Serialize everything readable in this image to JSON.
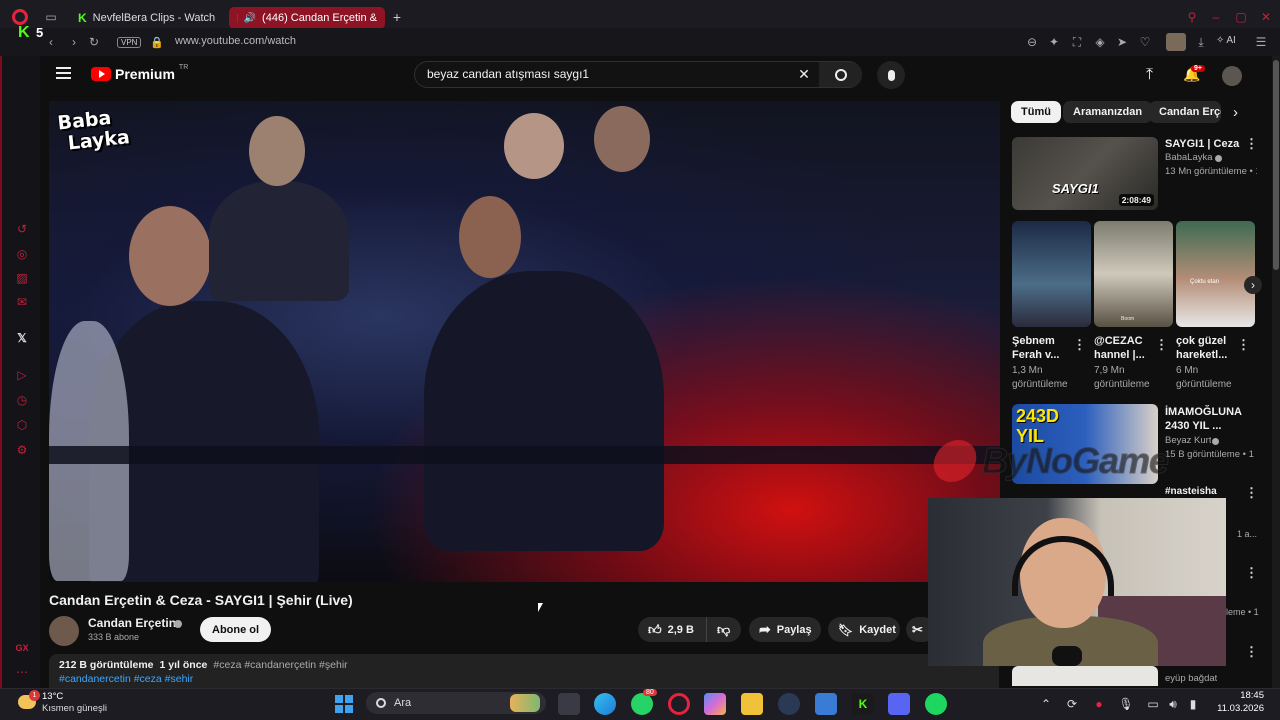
{
  "browser": {
    "badge_number": "5",
    "tabs": [
      {
        "label": "NevfelBera Clips - Watch L"
      },
      {
        "label": "(446) Candan Erçetin &"
      }
    ],
    "new_tab": "+",
    "vpn_label": "VPN",
    "url": "www.youtube.com/watch",
    "ai_label": "AI"
  },
  "youtube": {
    "logo_text": "Premium",
    "logo_sup": "TR",
    "search_value": "beyaz candan atışması saygı1",
    "notif_count": "9+"
  },
  "video": {
    "overlay_logo_line1": "Baba",
    "overlay_logo_line2": "Layka",
    "watermark": "ByNoGame",
    "title": "Candan Erçetin & Ceza - SAYGI1 | Şehir (Live)",
    "channel": "Candan Erçetin",
    "subscribers": "333 B abone",
    "subscribe_label": "Abone ol",
    "likes": "2,9 B",
    "share_label": "Paylaş",
    "save_label": "Kaydet",
    "views": "212 B görüntüleme",
    "age": "1 yıl önce",
    "hashtags_line1": "#ceza #candanerçetin #şehir",
    "hashtags_line2": "#candanercetin #ceza #sehir"
  },
  "chips": [
    "Tümü",
    "Aramanızdan",
    "Candan Erçe"
  ],
  "recommended": [
    {
      "title_line1": "SAYGI1 | Ceza",
      "channel": "BabaLayka",
      "meta": "13 Mn görüntüleme • 1",
      "duration": "2:08:49",
      "thumb_text": "SAYGI1"
    }
  ],
  "shorts": [
    {
      "title_line1": "Şebnem",
      "title_line2": "Ferah v...",
      "meta_line1": "1,3 Mn",
      "meta_line2": "görüntüleme"
    },
    {
      "title_line1": "@CEZAC",
      "title_line2": "hannel |...",
      "meta_line1": "7,9 Mn",
      "meta_line2": "görüntüleme",
      "thumb_text": "Boom"
    },
    {
      "title_line1": "çok güzel",
      "title_line2": "hareketl...",
      "meta_line1": "6 Mn",
      "meta_line2": "görüntüleme",
      "thumb_text": "Çoktu etan"
    }
  ],
  "recommended2": {
    "title_line1": "İMAMOĞLUNA",
    "title_line2": "2430 YIL ...",
    "channel": "Beyaz Kurt",
    "meta": "15 B görüntüleme • 1",
    "thumb_text": "243D YIL"
  },
  "partial_rows": {
    "hashtag": "#nasteisha",
    "meta_a": "1 a...",
    "meta_b": "leme • 1",
    "channel_c": "eyüp bağdat"
  },
  "taskbar": {
    "weather_temp": "13°C",
    "weather_desc": "Kısmen güneşli",
    "weather_badge": "1",
    "search_label": "Ara",
    "whatsapp_badge": "80",
    "time": "18:45",
    "date": "11.03.2026"
  },
  "colors": {
    "yt_red": "#ff0000",
    "browser_accent": "#c0233d",
    "bg": "#0f0f0f"
  }
}
